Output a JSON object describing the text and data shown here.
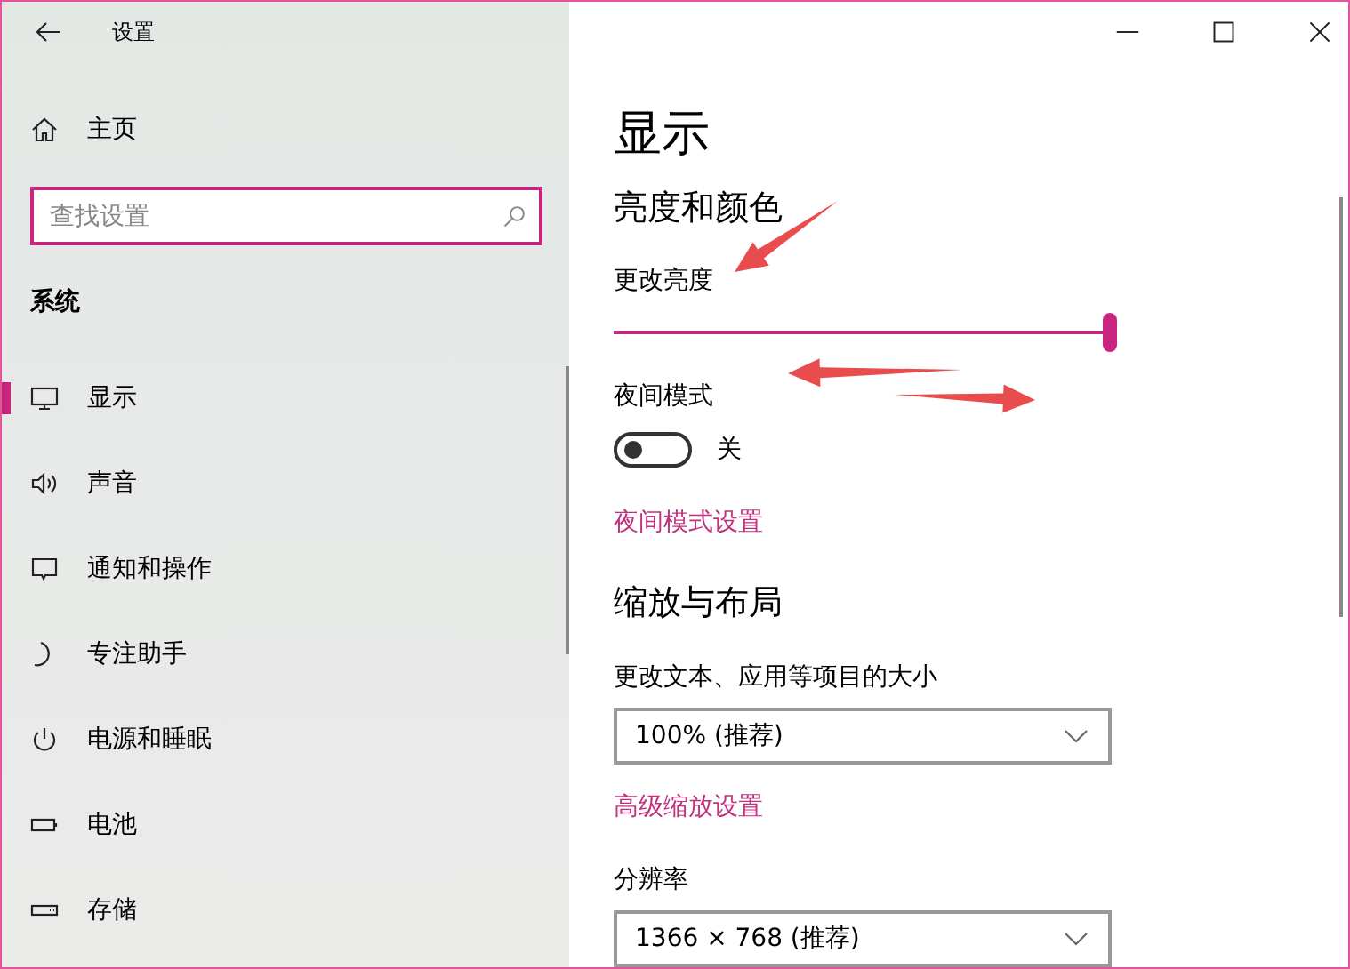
{
  "window": {
    "title": "设置"
  },
  "sidebar": {
    "home": "主页",
    "search": {
      "placeholder": "查找设置"
    },
    "section": "系统",
    "items": [
      {
        "label": "显示",
        "kind": "display",
        "selected": true
      },
      {
        "label": "声音",
        "kind": "sound",
        "selected": false
      },
      {
        "label": "通知和操作",
        "kind": "notifications",
        "selected": false
      },
      {
        "label": "专注助手",
        "kind": "focus",
        "selected": false
      },
      {
        "label": "电源和睡眠",
        "kind": "power",
        "selected": false
      },
      {
        "label": "电池",
        "kind": "battery",
        "selected": false
      },
      {
        "label": "存储",
        "kind": "storage",
        "selected": false
      }
    ]
  },
  "main": {
    "title": "显示",
    "brightness": {
      "heading": "亮度和颜色",
      "label": "更改亮度",
      "level": 1.0
    },
    "night_light": {
      "label": "夜间模式",
      "on": false,
      "state_text": "关",
      "link": "夜间模式设置"
    },
    "scale": {
      "heading": "缩放与布局",
      "label": "更改文本、应用等项目的大小",
      "value": "100% (推荐)",
      "link": "高级缩放设置"
    },
    "resolution": {
      "label": "分辨率",
      "value": "1366 × 768 (推荐)"
    }
  }
}
